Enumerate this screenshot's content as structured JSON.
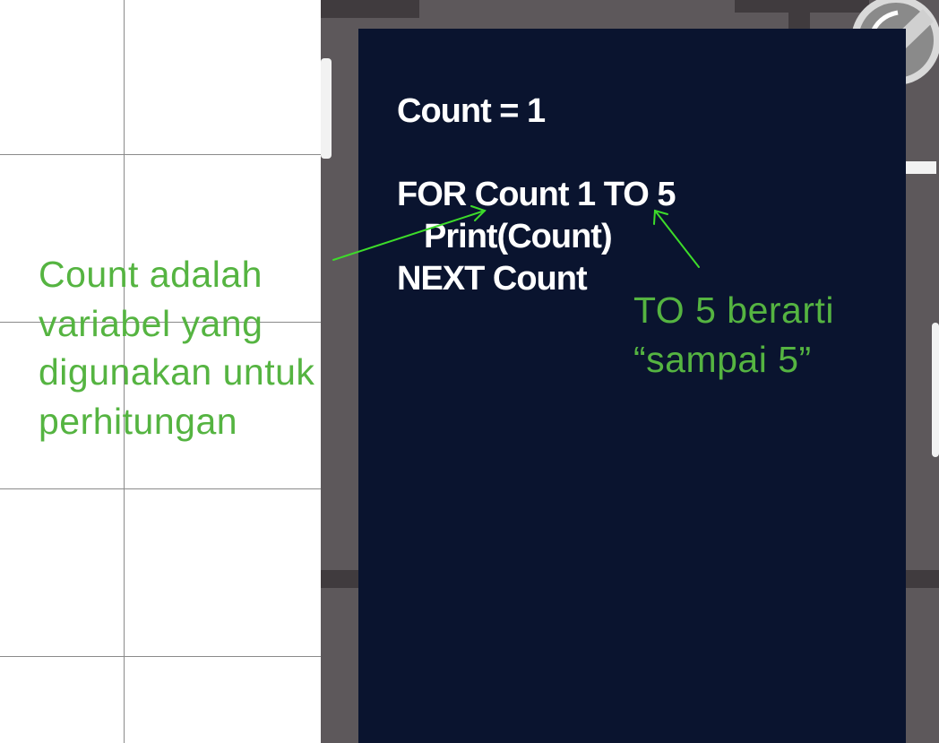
{
  "code": {
    "line1": "Count = 1",
    "line2": "FOR Count 1 TO 5",
    "line3": "Print(Count)",
    "line4": "NEXT Count"
  },
  "annotations": {
    "variable_note": [
      "Count adalah",
      "variabel yang",
      "digunakan untuk",
      "perhitungan"
    ],
    "to_note": [
      "TO 5 berarti",
      "“sampai 5”"
    ]
  },
  "colors": {
    "annotation": "#55b441",
    "arrow": "#3ddc2a",
    "screen": "#0a142f",
    "bezel": "#5d585b",
    "code_text": "#ffffff"
  },
  "icons": [
    "magnifier-lens-icon"
  ]
}
